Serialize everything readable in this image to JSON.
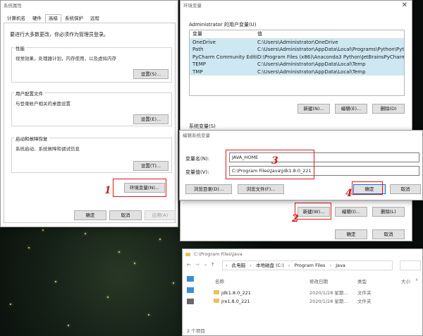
{
  "sysprops": {
    "title": "系统属性",
    "tabs": [
      "计算机名",
      "硬件",
      "高级",
      "系统保护",
      "远程"
    ],
    "admin_note": "要进行大多数更改，你必须作为管理员登录。",
    "perf_title": "性能",
    "perf_desc": "视觉效果，处理器计划，内存使用，以及虚拟内存",
    "profile_title": "用户配置文件",
    "profile_desc": "与登录帐户相关的桌面设置",
    "startup_title": "启动和故障恢复",
    "startup_desc": "系统启动、系统故障和调试信息",
    "settings_label": "设置(S)...",
    "settings_label_e": "设置(E)...",
    "settings_label_t": "设置(T)...",
    "envvars_label": "环境变量(N)...",
    "ok_label": "确定",
    "cancel_label": "取消",
    "apply_label": "应用(A)"
  },
  "envvars": {
    "title": "环境变量",
    "user_section": "Administrator 的用户变量(U)",
    "col_var": "变量",
    "col_val": "值",
    "rows": [
      {
        "name": "OneDrive",
        "value": "C:\\Users\\Administrator\\OneDrive"
      },
      {
        "name": "Path",
        "value": "C:\\Users\\Administrator\\AppData\\Local\\Programs\\Python\\Pyt..."
      },
      {
        "name": "PyCharm Community Editi...",
        "value": "D:\\Program Files (x86)\\Anaconda3 Python\\JetBrainsPyCharm..."
      },
      {
        "name": "TEMP",
        "value": "C:\\Users\\Administrator\\AppData\\Local\\Temp"
      },
      {
        "name": "TMP",
        "value": "C:\\Users\\Administrator\\AppData\\Local\\Temp"
      }
    ],
    "new_label": "新建(N)...",
    "edit_label": "编辑(E)...",
    "delete_label": "删除(D)",
    "sys_section": "系统变量(S)",
    "new_w_label": "新建(W)...",
    "edit_i_label": "编辑(I)...",
    "delete_l_label": "删除(L)",
    "ok_label": "确定",
    "cancel_label": "取消"
  },
  "editvar": {
    "title": "编辑系统变量",
    "name_label": "变量名(N):",
    "name_value": "JAVA_HOME",
    "value_label": "变量值(V):",
    "value_value": "C:\\Program Files\\Java\\jdk1.8.0_221",
    "browse_dir_label": "浏览目录(D)...",
    "browse_file_label": "浏览文件(F)...",
    "ok_label": "确定",
    "cancel_label": "取消"
  },
  "explorer": {
    "title": "C:\\Program Files\\Java",
    "breadcrumb": [
      "此电脑",
      "本地磁盘 (C:)",
      "Program Files",
      "Java"
    ],
    "col_name": "名称",
    "col_date": "修改日期",
    "col_type": "类型",
    "col_size": "大小",
    "items": [
      {
        "name": "jdk1.8.0_221",
        "date": "2020/1/28 星期...",
        "type": "文件夹"
      },
      {
        "name": "jre1.8.0_221",
        "date": "2020/1/28 星期...",
        "type": "文件夹"
      }
    ],
    "status": "2 个项目"
  },
  "steps": [
    "1",
    "2",
    "3",
    "4"
  ],
  "colors": {
    "accent": "#0078d7",
    "highlight": "#e0191b",
    "selection": "#cde8f2"
  }
}
